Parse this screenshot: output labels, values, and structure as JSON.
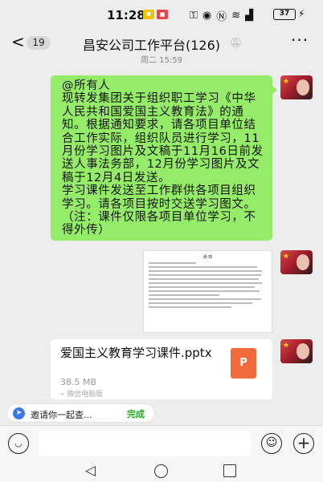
{
  "status_bar": {
    "time": "11:28",
    "battery": "37",
    "icons": [
      "key-icon",
      "eye-icon",
      "nfc-icon",
      "wifi-icon",
      "signal-icon",
      "charging-icon"
    ]
  },
  "header": {
    "unread_count": "19",
    "title": "昌安公司工作平台(126)"
  },
  "timestamp": "周二 15:59",
  "message": {
    "text": "@所有人\n现转发集团关于组织职工学习《中华人民共和国爱国主义教育法》的通知。根据通知要求，请各项目单位结合工作实际，组织队员进行学习，11月份学习图片及文稿于11月16日前发送人事法务部，12月份学习图片及文稿于12月4日发送。\n学习课件发送至工作群供各项目组织学习。请各项目按时交送学习图文。（注：课件仅限各项目单位学习，不得外传）"
  },
  "image_message": {
    "doc_title": "通 知"
  },
  "file_message": {
    "name": "爱国主义教育学习课件.pptx",
    "size": "38.5 MB",
    "type_label": "P",
    "source": "微信电脑版"
  },
  "invite_pill": {
    "text": "邀请你一起查...",
    "done": "完成"
  },
  "input_bar": {
    "placeholder": ""
  },
  "colors": {
    "bubble_green": "#95ec69",
    "background": "#ededed",
    "ppt_orange": "#f26b3c",
    "done_green": "#1aad19"
  }
}
